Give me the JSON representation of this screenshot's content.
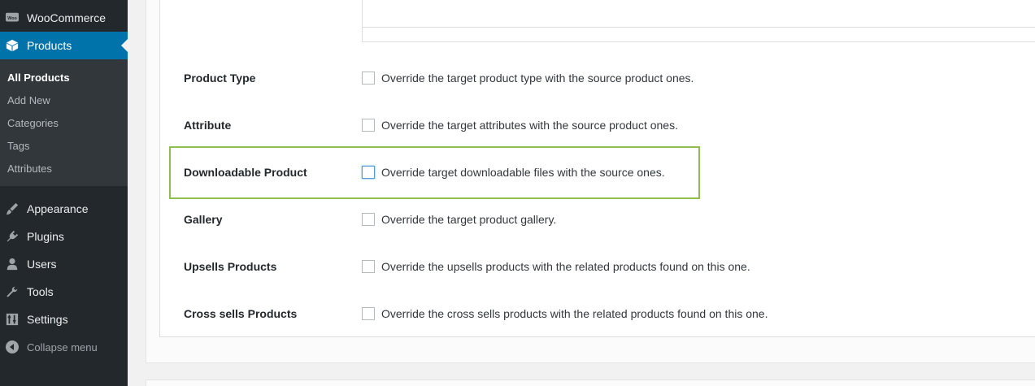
{
  "sidebar": {
    "woocommerce": {
      "label": "WooCommerce",
      "icon": "woo-icon"
    },
    "products": {
      "label": "Products",
      "icon": "products-box-icon"
    },
    "submenu": [
      "All Products",
      "Add New",
      "Categories",
      "Tags",
      "Attributes"
    ],
    "appearance": {
      "label": "Appearance",
      "icon": "paintbrush-icon"
    },
    "plugins": {
      "label": "Plugins",
      "icon": "plug-icon"
    },
    "users": {
      "label": "Users",
      "icon": "user-icon"
    },
    "tools": {
      "label": "Tools",
      "icon": "wrench-icon"
    },
    "settings": {
      "label": "Settings",
      "icon": "settings-sliders-icon"
    },
    "collapse": {
      "label": "Collapse menu",
      "icon": "collapse-arrow-icon"
    }
  },
  "options": [
    {
      "label": "Product Type",
      "description": "Override the target product type with the source product ones."
    },
    {
      "label": "Attribute",
      "description": "Override the target attributes with the source product ones."
    },
    {
      "label": "Downloadable Product",
      "description": "Override target downloadable files with the source ones."
    },
    {
      "label": "Gallery",
      "description": "Override the target product gallery."
    },
    {
      "label": "Upsells Products",
      "description": "Override the upsells products with the related products found on this one."
    },
    {
      "label": "Cross sells Products",
      "description": "Override the cross sells products with the related products found on this one."
    }
  ],
  "colors": {
    "sidebar_bg": "#23282d",
    "active_bg": "#0073aa",
    "highlight_border": "#8fbe4f"
  }
}
